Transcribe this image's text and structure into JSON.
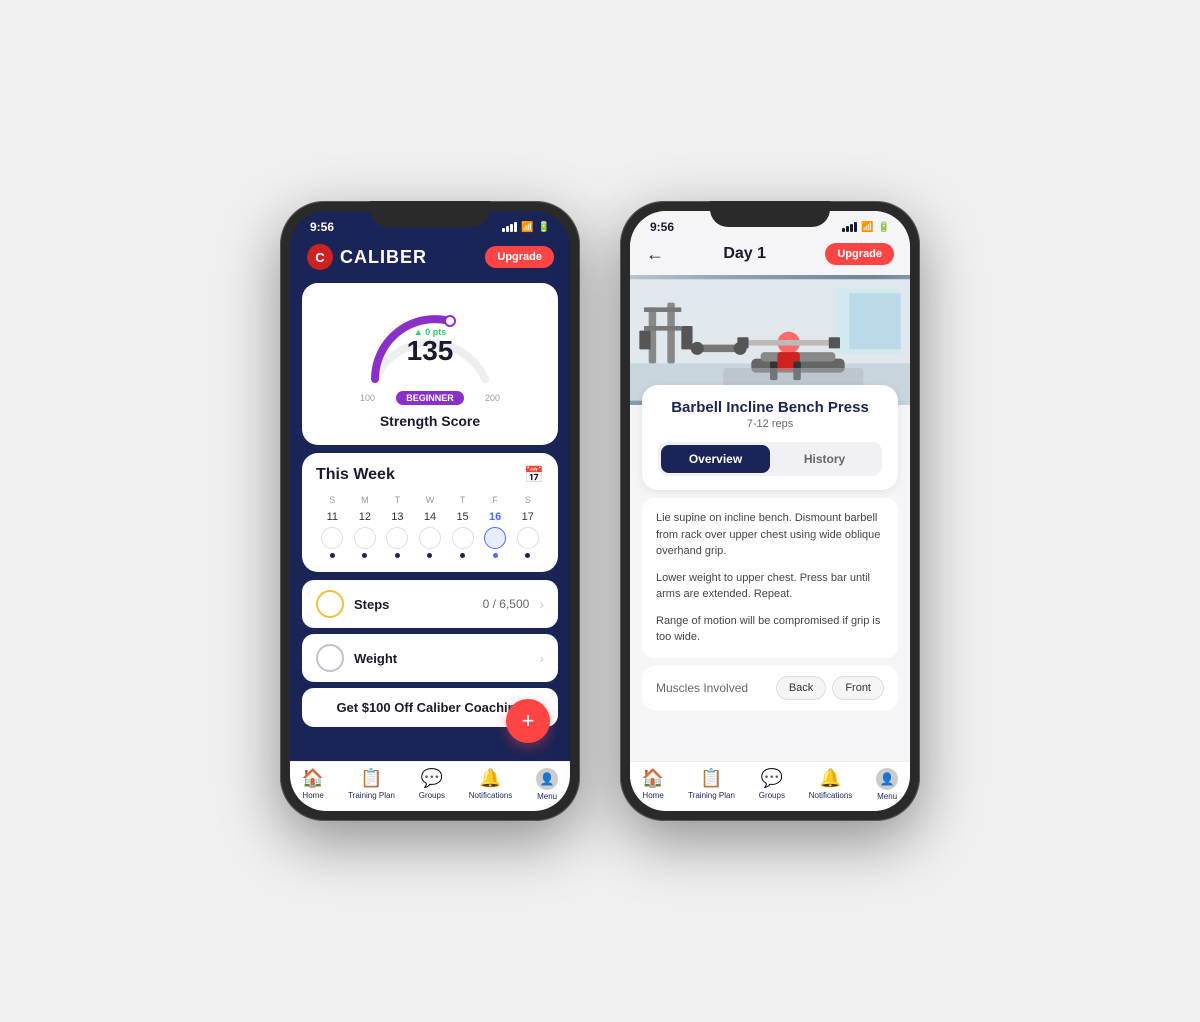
{
  "phone1": {
    "status": {
      "time": "9:56",
      "signal": true,
      "wifi": true,
      "battery": true
    },
    "header": {
      "logo_text": "CALIBER",
      "upgrade_label": "Upgrade"
    },
    "score_card": {
      "delta": "▲ 0 pts",
      "number": "135",
      "badge": "BEGINNER",
      "range_low": "100",
      "range_high": "200",
      "label": "Strength Score"
    },
    "week": {
      "title": "This Week",
      "days": [
        "S",
        "M",
        "T",
        "W",
        "T",
        "F",
        "S"
      ],
      "dates": [
        "11",
        "12",
        "13",
        "14",
        "15",
        "16",
        "17"
      ],
      "today_index": 5
    },
    "steps": {
      "label": "Steps",
      "value": "0 / 6,500"
    },
    "weight": {
      "label": "Weight"
    },
    "promo": {
      "text": "Get $100 Off Caliber Coaching"
    },
    "nav": {
      "items": [
        {
          "label": "Home",
          "icon": "🏠"
        },
        {
          "label": "Training Plan",
          "icon": "📋"
        },
        {
          "label": "Groups",
          "icon": "💬"
        },
        {
          "label": "Notifications",
          "icon": "🔔"
        },
        {
          "label": "Menu",
          "icon": "👤"
        }
      ]
    }
  },
  "phone2": {
    "status": {
      "time": "9:56"
    },
    "header": {
      "title": "Day 1",
      "upgrade_label": "Upgrade"
    },
    "exercise": {
      "title": "Barbell Incline Bench Press",
      "reps": "7-12 reps"
    },
    "tabs": {
      "active": "Overview",
      "inactive": "History"
    },
    "description": {
      "para1": "Lie supine on incline bench. Dismount barbell from rack over upper chest using wide oblique overhand grip.",
      "para2": "Lower weight to upper chest. Press bar until arms are extended. Repeat.",
      "para3": "Range of motion will be compromised if grip is too wide."
    },
    "muscles": {
      "label": "Muscles Involved",
      "back_label": "Back",
      "front_label": "Front"
    },
    "nav": {
      "items": [
        {
          "label": "Home",
          "icon": "🏠"
        },
        {
          "label": "Training Plan",
          "icon": "📋"
        },
        {
          "label": "Groups",
          "icon": "💬"
        },
        {
          "label": "Notifications",
          "icon": "🔔"
        },
        {
          "label": "Menu",
          "icon": "👤"
        }
      ]
    }
  }
}
